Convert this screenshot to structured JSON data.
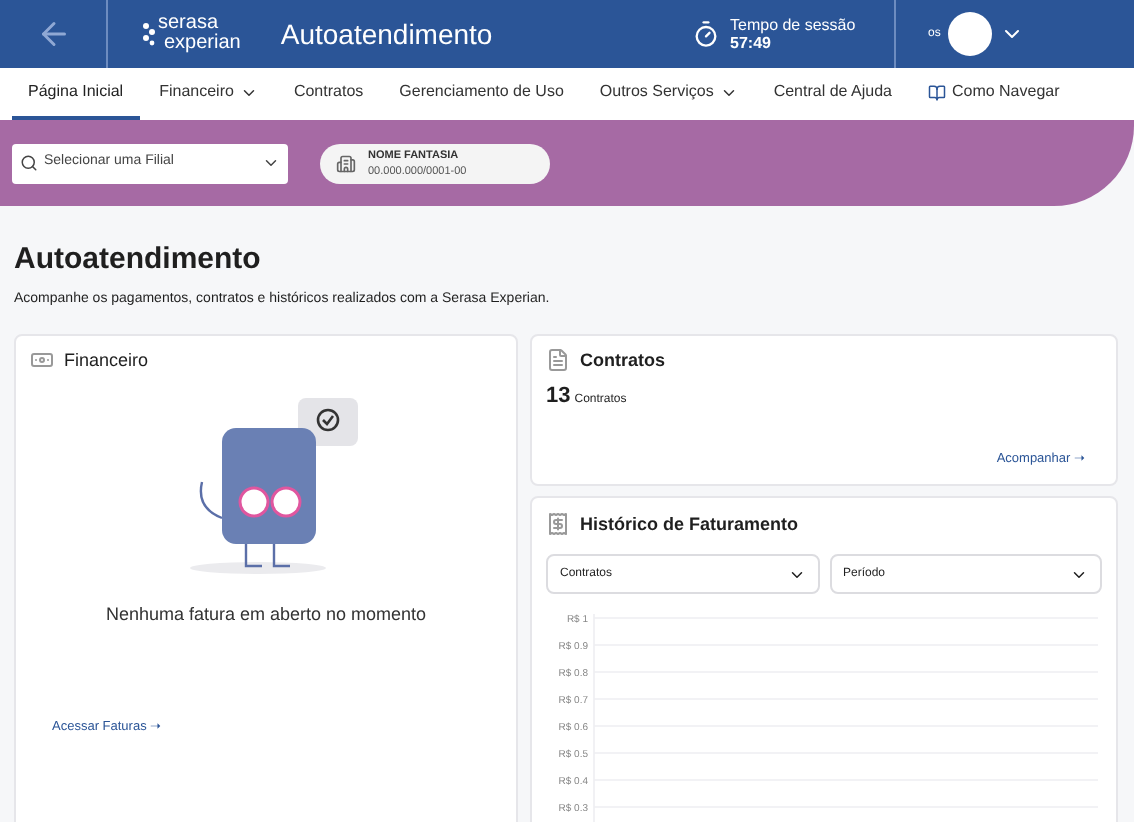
{
  "header": {
    "logo_lines": [
      "serasa",
      "experian"
    ],
    "title": "Autoatendimento",
    "session_label": "Tempo de sessão",
    "session_time": "57:49",
    "user_label": "os"
  },
  "nav": [
    {
      "label": "Página Inicial",
      "kind": "link",
      "selected": true
    },
    {
      "label": "Financeiro",
      "kind": "menu",
      "selected": false
    },
    {
      "label": "Contratos",
      "kind": "link",
      "selected": false
    },
    {
      "label": "Gerenciamento de Uso",
      "kind": "link",
      "selected": false
    },
    {
      "label": "Outros Serviços",
      "kind": "menu",
      "selected": false
    },
    {
      "label": "Central de Ajuda",
      "kind": "link",
      "selected": false
    },
    {
      "label": "Como Navegar",
      "kind": "guide",
      "selected": false
    }
  ],
  "branch_select": {
    "placeholder": "Selecionar uma Filial"
  },
  "company": {
    "name": "NOME FANTASIA",
    "document": "00.000.000/0001-00"
  },
  "page": {
    "title": "Autoatendimento",
    "subtitle": "Acompanhe os pagamentos, contratos e históricos realizados com a Serasa Experian."
  },
  "financeiro": {
    "title": "Financeiro",
    "message": "Nenhuma fatura em aberto no momento",
    "link": "Acessar Faturas ➝"
  },
  "contratos": {
    "title": "Contratos",
    "count": "13",
    "count_label": "Contratos",
    "link": "Acompanhar ➝"
  },
  "historico": {
    "title": "Histórico de Faturamento",
    "filters": [
      {
        "value": "Contratos"
      },
      {
        "value": "Período"
      }
    ],
    "axis_labels": [
      "R$ 1",
      "R$ 0.9",
      "R$ 0.8",
      "R$ 0.7",
      "R$ 0.6",
      "R$ 0.5",
      "R$ 0.4",
      "R$ 0.3"
    ]
  }
}
